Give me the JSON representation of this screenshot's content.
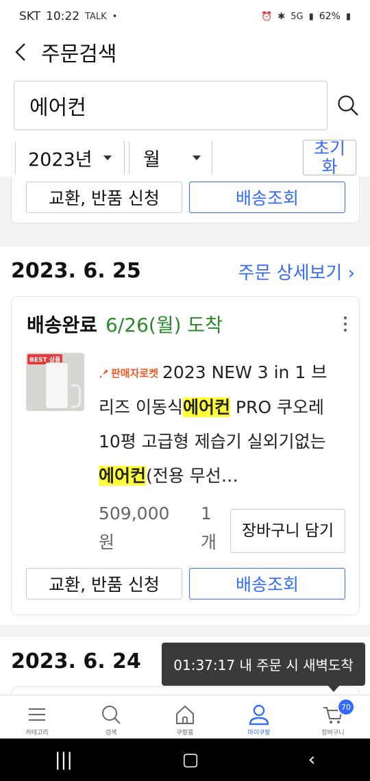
{
  "status_bar": {
    "carrier": "SKT",
    "time": "10:22",
    "talk_label": "TALK",
    "battery": "62%",
    "network": "5G"
  },
  "header": {
    "title": "주문검색"
  },
  "search": {
    "value": "에어컨"
  },
  "filters": {
    "year": "2023년",
    "month": "월",
    "reset_label": "초기화"
  },
  "top_card": {
    "exchange_label": "교환, 반품 신청",
    "tracking_label": "배송조회"
  },
  "order_group": {
    "date": "2023. 6. 25",
    "detail_link": "주문 상세보기 ›",
    "status": "배송완료",
    "arrival": "6/26(월) 도착",
    "badge": "BEST 상품",
    "seller_label": "판매자로켓",
    "title_part1": "2023 NEW 3 in 1 브리즈 이동식",
    "title_hl1": "에어컨",
    "title_part2": " PRO 쿠오레 10평 고급형 제습기 실외기없는 ",
    "title_hl2": "에어컨",
    "title_part3": "(전용 무선…",
    "price": "509,000 원",
    "quantity": "1 개",
    "cart_label": "장바구니 담기",
    "exchange_label": "교환, 반품 신청",
    "tracking_label": "배송조회"
  },
  "next_group": {
    "date": "2023. 6. 24"
  },
  "toast": {
    "text": "01:37:17 내 주문 시 새벽도착"
  },
  "bottom_nav": {
    "items": [
      {
        "label": "카테고리",
        "icon": "menu-icon"
      },
      {
        "label": "검색",
        "icon": "search-icon"
      },
      {
        "label": "쿠팡홈",
        "icon": "home-icon"
      },
      {
        "label": "마이쿠팡",
        "icon": "person-icon"
      },
      {
        "label": "장바구니",
        "icon": "cart-icon"
      }
    ],
    "cart_count": "70"
  },
  "colors": {
    "accent": "#346aff",
    "status_green": "#2a8a2a",
    "highlight": "#ffff3a"
  }
}
